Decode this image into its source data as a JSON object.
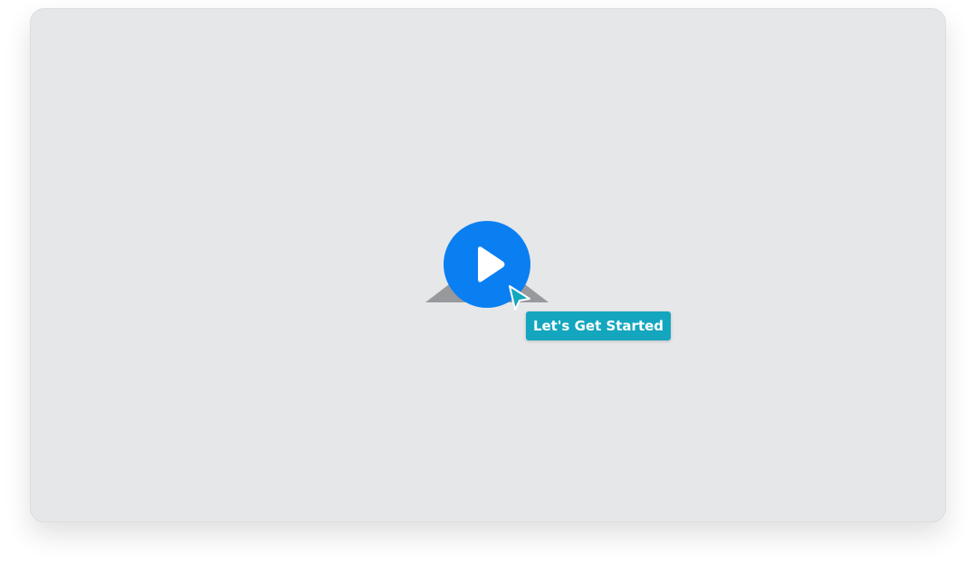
{
  "player": {
    "play_icon": "play-icon",
    "placeholder_icon": "image-placeholder-icon",
    "cta_label": "Let's Get Started"
  },
  "colors": {
    "background": "#e6e7e9",
    "play_button": "#0a7ff2",
    "tooltip": "#14a6bf",
    "cursor": "#14a6bf"
  }
}
